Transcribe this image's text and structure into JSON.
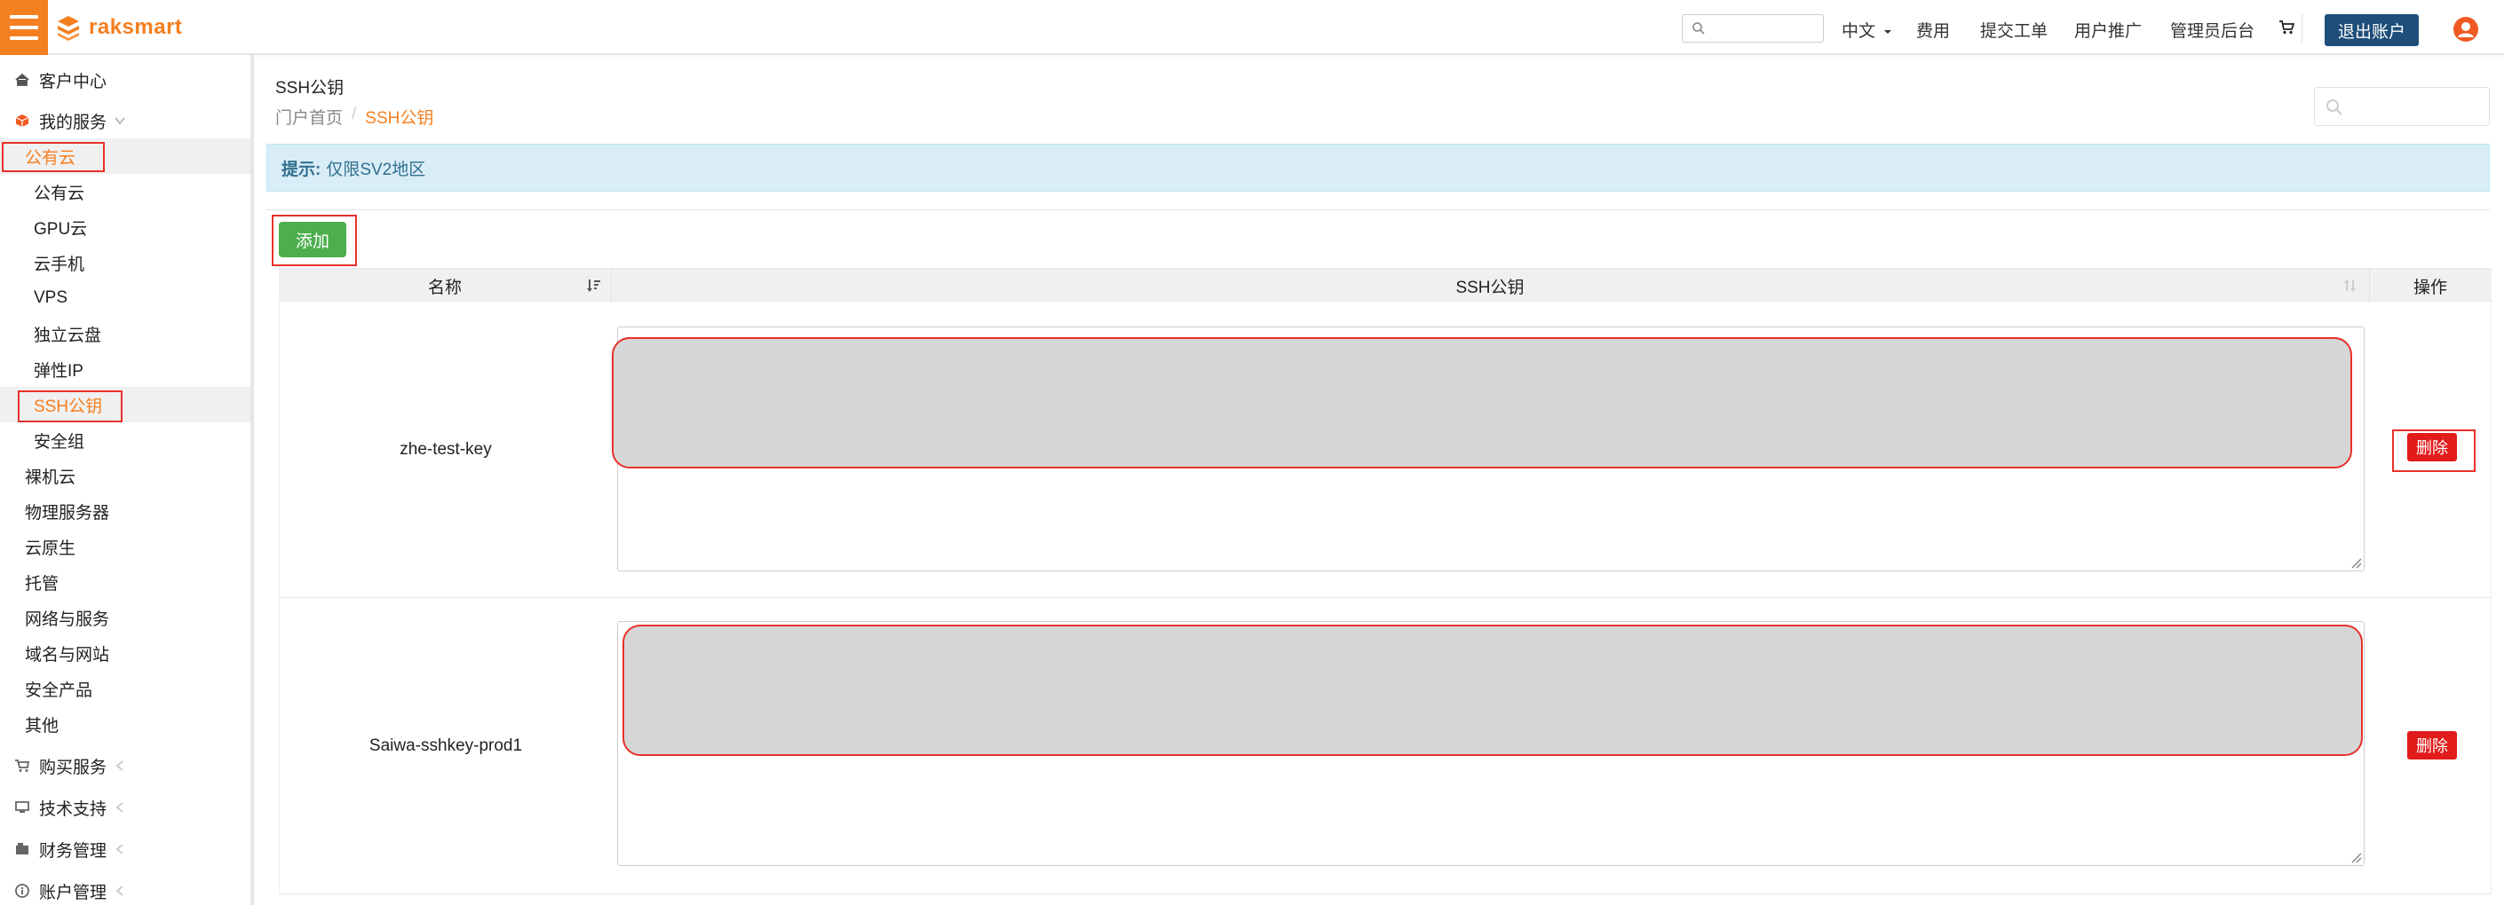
{
  "header": {
    "brand": "raksmart",
    "search_placeholder": "",
    "nav": [
      "中文",
      "费用",
      "提交工单",
      "用户推广",
      "管理员后台"
    ],
    "logout_label": "退出账户"
  },
  "sidebar": {
    "items": [
      {
        "label": "客户中心"
      },
      {
        "label": "我的服务"
      },
      {
        "label": "公有云"
      },
      {
        "label": "公有云"
      },
      {
        "label": "GPU云"
      },
      {
        "label": "云手机"
      },
      {
        "label": "VPS"
      },
      {
        "label": "独立云盘"
      },
      {
        "label": "弹性IP"
      },
      {
        "label": "SSH公钥"
      },
      {
        "label": "安全组"
      },
      {
        "label": "裸机云"
      },
      {
        "label": "物理服务器"
      },
      {
        "label": "云原生"
      },
      {
        "label": "托管"
      },
      {
        "label": "网络与服务"
      },
      {
        "label": "域名与网站"
      },
      {
        "label": "安全产品"
      },
      {
        "label": "其他"
      },
      {
        "label": "购买服务"
      },
      {
        "label": "技术支持"
      },
      {
        "label": "财务管理"
      },
      {
        "label": "账户管理"
      }
    ]
  },
  "main": {
    "title": "SSH公钥",
    "breadcrumb": {
      "home": "门户首页",
      "sep": "/",
      "current": "SSH公钥"
    },
    "notice": {
      "label": "提示:",
      "text": "仅限SV2地区"
    },
    "add_label": "添加",
    "table": {
      "headers": {
        "name": "名称",
        "key": "SSH公钥",
        "ops": "操作"
      },
      "rows": [
        {
          "name": "zhe-test-key",
          "delete_label": "删除"
        },
        {
          "name": "Saiwa-sshkey-prod1",
          "delete_label": "删除"
        }
      ]
    }
  },
  "colors": {
    "brand_orange": "#f47f20",
    "logout_blue": "#1e4e79",
    "add_green": "#4cae4c",
    "delete_red": "#e21b1b",
    "notice_bg": "#d9edf7"
  }
}
